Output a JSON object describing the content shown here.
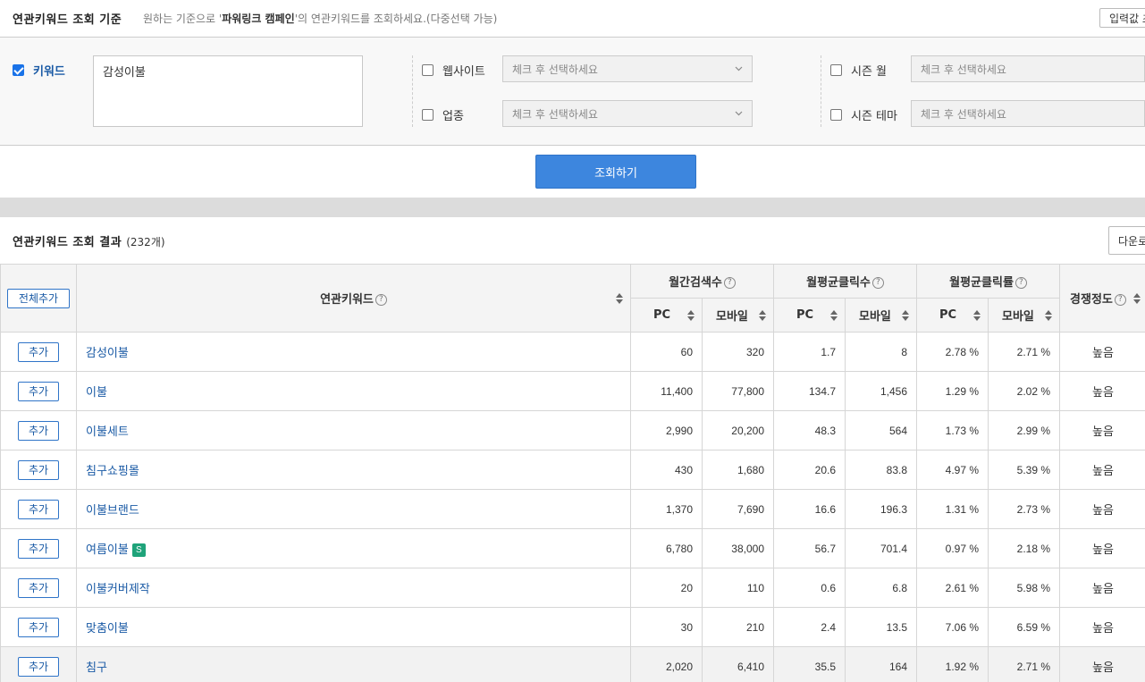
{
  "criteria": {
    "title": "연관키워드 조회 기준",
    "desc_prefix": "원하는 기준으로 '",
    "desc_bold": "파워링크 캠페인",
    "desc_suffix": "'의 연관키워드를 조회하세요.(다중선택 가능)",
    "reset_label": "입력값 초기화"
  },
  "filters": {
    "keyword_label": "키워드",
    "keyword_checked": true,
    "keyword_value": "감성이불",
    "website_label": "웹사이트",
    "industry_label": "업종",
    "season_month_label": "시즌 월",
    "season_theme_label": "시즌 테마",
    "select_placeholder": "체크 후 선택하세요"
  },
  "search_button": "조회하기",
  "results": {
    "title": "연관키워드 조회 결과",
    "count": "(232개)",
    "download_label": "다운로드"
  },
  "table": {
    "add_all": "전체추가",
    "col_keyword": "연관키워드",
    "col_monthly_search": "월간검색수",
    "col_avg_clicks": "월평균클릭수",
    "col_avg_ctr": "월평균클릭률",
    "col_competition": "경쟁정도",
    "sub_pc": "PC",
    "sub_mobile": "모바일",
    "add_label": "추가",
    "rows": [
      {
        "keyword": "감성이불",
        "badge": "",
        "pc": "60",
        "mobile": "320",
        "click_pc": "1.7",
        "click_mobile": "8",
        "ctr_pc": "2.78 %",
        "ctr_mobile": "2.71 %",
        "competition": "높음"
      },
      {
        "keyword": "이불",
        "badge": "",
        "pc": "11,400",
        "mobile": "77,800",
        "click_pc": "134.7",
        "click_mobile": "1,456",
        "ctr_pc": "1.29 %",
        "ctr_mobile": "2.02 %",
        "competition": "높음"
      },
      {
        "keyword": "이불세트",
        "badge": "",
        "pc": "2,990",
        "mobile": "20,200",
        "click_pc": "48.3",
        "click_mobile": "564",
        "ctr_pc": "1.73 %",
        "ctr_mobile": "2.99 %",
        "competition": "높음"
      },
      {
        "keyword": "침구쇼핑몰",
        "badge": "",
        "pc": "430",
        "mobile": "1,680",
        "click_pc": "20.6",
        "click_mobile": "83.8",
        "ctr_pc": "4.97 %",
        "ctr_mobile": "5.39 %",
        "competition": "높음"
      },
      {
        "keyword": "이불브랜드",
        "badge": "",
        "pc": "1,370",
        "mobile": "7,690",
        "click_pc": "16.6",
        "click_mobile": "196.3",
        "ctr_pc": "1.31 %",
        "ctr_mobile": "2.73 %",
        "competition": "높음"
      },
      {
        "keyword": "여름이불",
        "badge": "S",
        "pc": "6,780",
        "mobile": "38,000",
        "click_pc": "56.7",
        "click_mobile": "701.4",
        "ctr_pc": "0.97 %",
        "ctr_mobile": "2.18 %",
        "competition": "높음"
      },
      {
        "keyword": "이불커버제작",
        "badge": "",
        "pc": "20",
        "mobile": "110",
        "click_pc": "0.6",
        "click_mobile": "6.8",
        "ctr_pc": "2.61 %",
        "ctr_mobile": "5.98 %",
        "competition": "높음"
      },
      {
        "keyword": "맞춤이불",
        "badge": "",
        "pc": "30",
        "mobile": "210",
        "click_pc": "2.4",
        "click_mobile": "13.5",
        "ctr_pc": "7.06 %",
        "ctr_mobile": "6.59 %",
        "competition": "높음"
      },
      {
        "keyword": "침구",
        "badge": "",
        "pc": "2,020",
        "mobile": "6,410",
        "click_pc": "35.5",
        "click_mobile": "164",
        "ctr_pc": "1.92 %",
        "ctr_mobile": "2.71 %",
        "competition": "높음"
      }
    ]
  },
  "colors": {
    "accent": "#3d86de",
    "link": "#1a5aa5",
    "badge": "#1fa37a"
  }
}
